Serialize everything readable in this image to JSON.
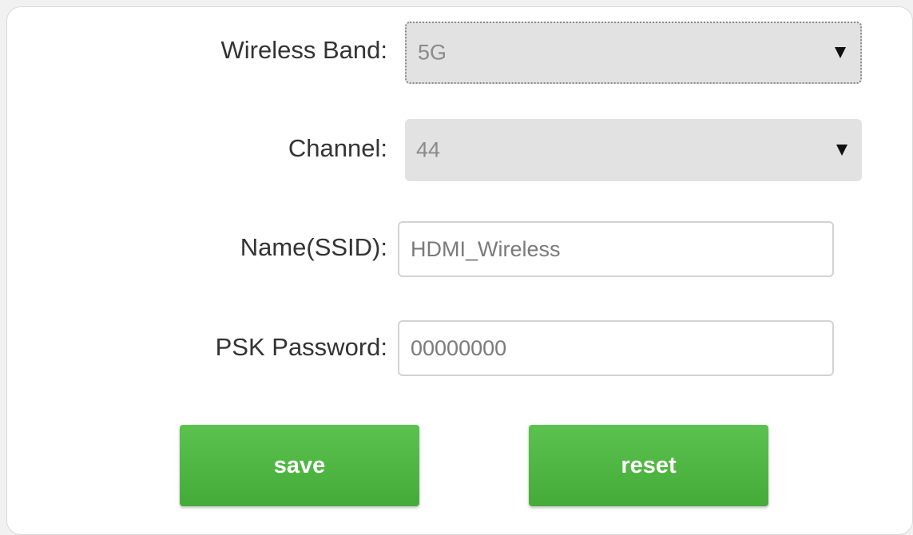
{
  "form": {
    "wireless_band": {
      "label": "Wireless Band:",
      "value": "5G"
    },
    "channel": {
      "label": "Channel:",
      "value": "44"
    },
    "ssid": {
      "label": "Name(SSID):",
      "value": "HDMI_Wireless"
    },
    "psk_password": {
      "label": "PSK Password:",
      "value": "00000000"
    }
  },
  "buttons": {
    "save_label": "save",
    "reset_label": "reset"
  },
  "colors": {
    "button_green": "#4cb640",
    "select_bg": "#e2e2e2"
  }
}
